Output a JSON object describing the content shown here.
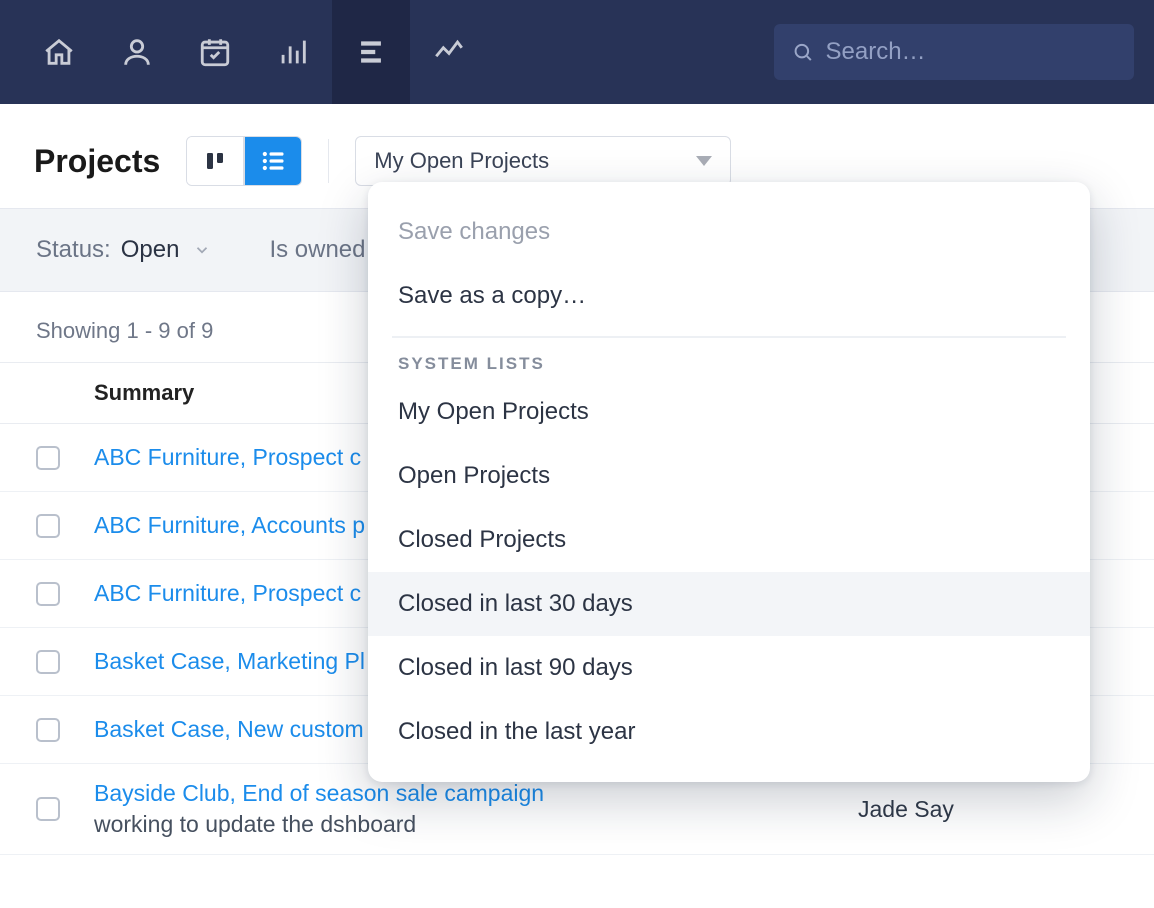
{
  "nav": {
    "search_placeholder": "Search…",
    "icons": [
      "home-icon",
      "person-icon",
      "calendar-icon",
      "bar-chart-icon",
      "list-icon",
      "trend-icon"
    ]
  },
  "header": {
    "title": "Projects",
    "filter_selected": "My Open Projects"
  },
  "filters": {
    "status_label": "Status:",
    "status_value": "Open",
    "second_label": "Is owned"
  },
  "results": {
    "meta": "Showing 1 - 9 of 9",
    "summary_col": "Summary"
  },
  "rows": [
    {
      "summary": "ABC Furniture, Prospect c",
      "sub": "",
      "owner": ""
    },
    {
      "summary": "ABC Furniture, Accounts p",
      "sub": "",
      "owner": ""
    },
    {
      "summary": "ABC Furniture, Prospect c",
      "sub": "",
      "owner": ""
    },
    {
      "summary": "Basket Case, Marketing Pl",
      "sub": "",
      "owner": ""
    },
    {
      "summary": "Basket Case, New custom",
      "sub": "",
      "owner": ""
    },
    {
      "summary": "Bayside Club, End of season sale campaign",
      "sub": "working to update the dshboard",
      "owner": "Jade Say"
    }
  ],
  "dropdown": {
    "save_changes": "Save changes",
    "save_as_copy": "Save as a copy…",
    "heading": "SYSTEM LISTS",
    "items": [
      "My Open Projects",
      "Open Projects",
      "Closed Projects",
      "Closed in last 30 days",
      "Closed in last 90 days",
      "Closed in the last year"
    ],
    "hovered_index": 3
  }
}
